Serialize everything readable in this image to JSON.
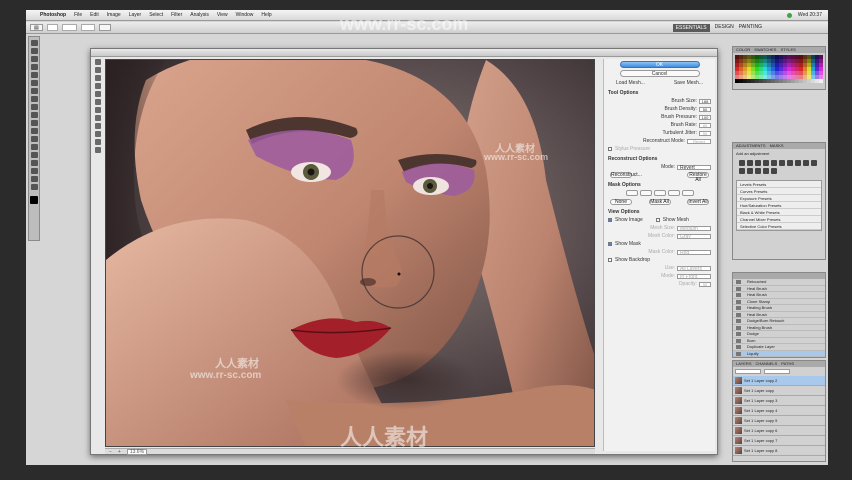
{
  "menubar": {
    "app_name": "Photoshop",
    "items": [
      "File",
      "Edit",
      "Image",
      "Layer",
      "Select",
      "Filter",
      "Analysis",
      "View",
      "Window",
      "Help"
    ],
    "clock": "Wed 20:37"
  },
  "optionsbar": {
    "workspace_active": "ESSENTIALS",
    "workspace_items": [
      "DESIGN",
      "PAINTING"
    ]
  },
  "liquify": {
    "ok_label": "OK",
    "cancel_label": "Cancel",
    "load_mesh": "Load Mesh...",
    "save_mesh": "Save Mesh...",
    "tool_options_title": "Tool Options",
    "tool_options": [
      {
        "label": "Brush Size:",
        "value": "188"
      },
      {
        "label": "Brush Density:",
        "value": "50"
      },
      {
        "label": "Brush Pressure:",
        "value": "100"
      },
      {
        "label": "Brush Rate:",
        "value": "80"
      },
      {
        "label": "Turbulent Jitter:",
        "value": "50"
      },
      {
        "label": "Reconstruct Mode:",
        "value": "Revert"
      }
    ],
    "stylus_pressure": "Stylus Pressure",
    "reconstruct_title": "Reconstruct Options",
    "mode_label": "Mode:",
    "mode_value": "Revert",
    "reconstruct_btn": "Reconstruct...",
    "restore_all": "Restore All",
    "mask_title": "Mask Options",
    "none": "None",
    "mask_all": "Mask All",
    "invert_all": "Invert All",
    "view_title": "View Options",
    "show_image": "Show Image",
    "show_mesh": "Show Mesh",
    "mesh_size": "Mesh Size:",
    "mesh_size_val": "Medium",
    "mesh_color": "Mesh Color:",
    "mesh_color_val": "Gray",
    "show_mask": "Show Mask",
    "mask_color": "Mask Color:",
    "mask_color_val": "Red",
    "show_backdrop": "Show Backdrop",
    "use": "Use:",
    "use_val": "All Layers",
    "backdrop_mode": "Mode:",
    "backdrop_mode_val": "In Front",
    "opacity": "Opacity:",
    "opacity_val": "50",
    "zoom": "13.6%"
  },
  "panels": {
    "swatch_tabs": [
      "COLOR",
      "SWATCHES",
      "STYLES"
    ],
    "adjust_tabs": [
      "ADJUSTMENTS",
      "MASKS"
    ],
    "adjust_title": "Add an adjustment",
    "presets": [
      "Levels Presets",
      "Curves Presets",
      "Exposure Presets",
      "Hue/Saturation Presets",
      "Black & White Presets",
      "Channel Mixer Presets",
      "Selective Color Presets"
    ],
    "history": [
      "Retouched",
      "Heal Brush",
      "Heal Brush",
      "Clone Stamp",
      "Healing Brush",
      "Heal Brush",
      "Dodge/Burn Retouch",
      "Healing Brush",
      "Dodge",
      "Burn",
      "Duplicate Layer",
      "Liquify"
    ],
    "layer_tabs": [
      "LAYERS",
      "CHANNELS",
      "PATHS"
    ],
    "layers": [
      "Set 1 Layer copy 2",
      "Set 1 Layer copy",
      "Set 1 Layer copy 3",
      "Set 1 Layer copy 4",
      "Set 1 Layer copy 5",
      "Set 1 Layer copy 6",
      "Set 1 Layer copy 7",
      "Set 1 Layer copy 8"
    ]
  },
  "watermark": {
    "url": "www.rr-sc.com",
    "cn": "人人素材"
  },
  "colors": {
    "ok_button": "#3d8ce0",
    "selection": "#a9c9ec"
  }
}
